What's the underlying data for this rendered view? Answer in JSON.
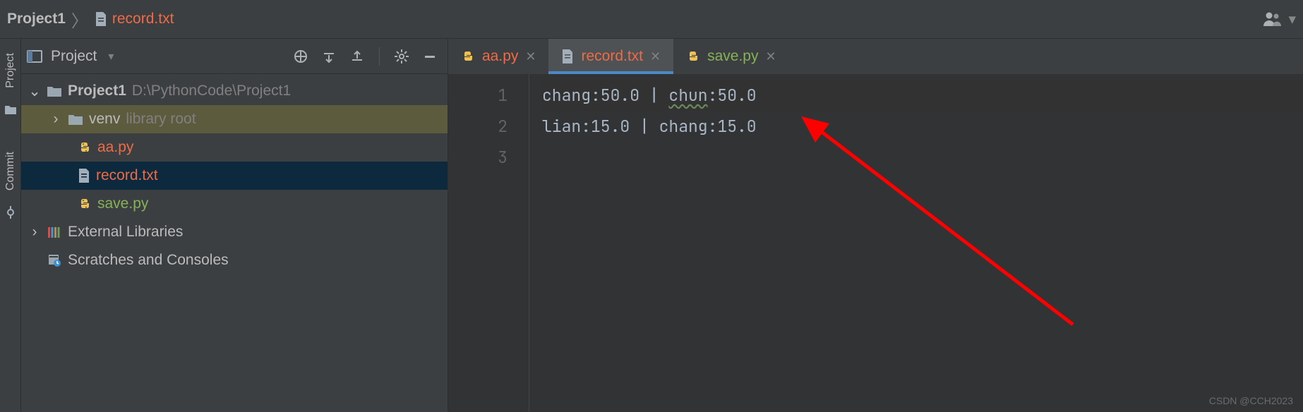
{
  "breadcrumb": {
    "project": "Project1",
    "file": "record.txt"
  },
  "panel": {
    "title": "Project"
  },
  "gutter": {
    "project": "Project",
    "commit": "Commit"
  },
  "tree": {
    "root_name": "Project1",
    "root_path": "D:\\PythonCode\\Project1",
    "venv": "venv",
    "venv_hint": "library root",
    "files": {
      "aa": "aa.py",
      "record": "record.txt",
      "save": "save.py"
    },
    "ext_lib": "External Libraries",
    "scratches": "Scratches and Consoles"
  },
  "tabs": {
    "aa": "aa.py",
    "record": "record.txt",
    "save": "save.py"
  },
  "editor": {
    "lines": {
      "l1_a": "chang:50.0 | ",
      "l1_b": "chun",
      "l1_c": ":50.0",
      "l2": "lian:15.0 | chang:15.0"
    },
    "linenums": {
      "n1": "1",
      "n2": "2",
      "n3": "3"
    }
  },
  "watermark": "CSDN @CCH2023"
}
